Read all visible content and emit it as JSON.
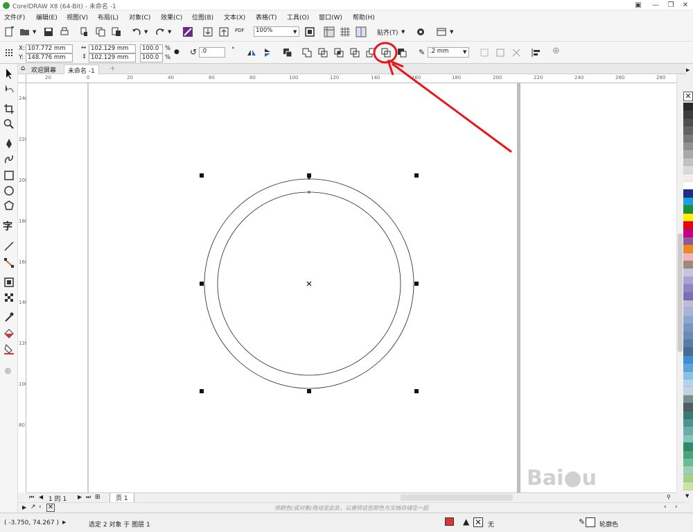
{
  "window": {
    "title": "CorelDRAW X8 (64-Bit) - 未命名 -1"
  },
  "menu": [
    "文件(F)",
    "编辑(E)",
    "视图(V)",
    "布局(L)",
    "对象(C)",
    "效果(C)",
    "位图(B)",
    "文本(X)",
    "表格(T)",
    "工具(O)",
    "窗口(W)",
    "帮助(H)"
  ],
  "toolbar": {
    "zoom": "100%",
    "snap_label": "贴齐(T)",
    "pdf_label": "PDF"
  },
  "props": {
    "x": "107.772 mm",
    "y": "148.776 mm",
    "width": "102.129 mm",
    "height": "102.129 mm",
    "scale_w": "100.0",
    "scale_h": "100.0",
    "pct": "%",
    "rotation": ".0",
    "outline": ".2 mm",
    "x_label": "X:",
    "y_label": "Y:"
  },
  "tabs": {
    "welcome": "欢迎屏幕",
    "doc": "未命名 -1"
  },
  "ruler": {
    "h_ticks": [
      "20",
      "0",
      "20",
      "40",
      "60",
      "80",
      "100",
      "120",
      "140",
      "160",
      "180",
      "200",
      "220",
      "240",
      "260",
      "280"
    ],
    "v_ticks": [
      "240",
      "220",
      "200",
      "180",
      "160",
      "140",
      "120",
      "100",
      "80"
    ]
  },
  "pagenav": {
    "page_of": "1 的 1",
    "page_tab": "页 1"
  },
  "hint": "将颜色(或对象)拖动至此处，以便将这些颜色与文档存储在一起",
  "status": {
    "coords": "( -3.750, 74.267 )",
    "selection": "选定 2 对象 于 图层 1",
    "fill": "无",
    "outline": "轮廓色"
  },
  "palette_colors": [
    "#2a2a2a",
    "#3d3d3d",
    "#4f4f4f",
    "#646464",
    "#7a7a7a",
    "#919191",
    "#a9a9a9",
    "#c2c2c2",
    "#dadada",
    "#efefef",
    "#ffffff",
    "#1d2f87",
    "#1aa1e2",
    "#1f8f3d",
    "#fff000",
    "#e30613",
    "#c6007e",
    "#8e5a9e",
    "#ec8a1f",
    "#f3b4c0",
    "#9e8a7a",
    "#c9c3dd",
    "#a8a4d3",
    "#8e87c6",
    "#7b6fb5",
    "#bfbad9",
    "#a7b6d8",
    "#8fa6cf",
    "#7796c5",
    "#6b8ab8",
    "#5a7aa7",
    "#4a6a97",
    "#3d8fd0",
    "#5aa6dc",
    "#8cc0e6",
    "#b2d3ee",
    "#c2d4d8",
    "#7a8c8f",
    "#4d5f62",
    "#3a7a78",
    "#4d948e",
    "#6aaea6",
    "#86c4b8",
    "#2f8a6a",
    "#4aa27e",
    "#6cbc93",
    "#9ad2b1",
    "#a5d08a",
    "#c9e2a6"
  ],
  "colors": {
    "arrow": "#e8161b",
    "palette_selected": "#111111"
  }
}
